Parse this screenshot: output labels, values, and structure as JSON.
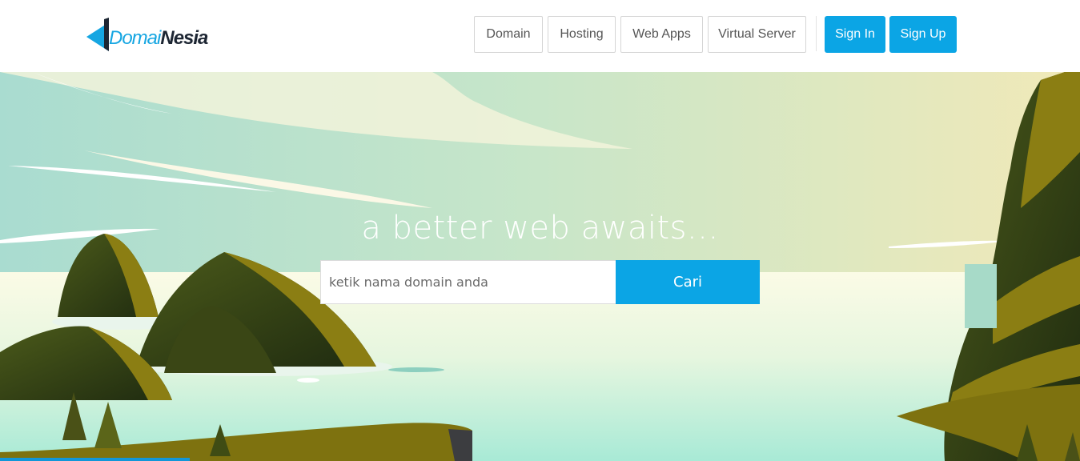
{
  "brand": {
    "name_part1": "Domai",
    "name_part2": "Nesia",
    "color_accent": "#16a6e2",
    "color_dark": "#1d2633"
  },
  "nav": {
    "items": [
      {
        "label": "Domain"
      },
      {
        "label": "Hosting"
      },
      {
        "label": "Web Apps"
      },
      {
        "label": "Virtual Server"
      }
    ],
    "sign_in": "Sign In",
    "sign_up": "Sign Up"
  },
  "hero": {
    "tagline": "a better web awaits...",
    "search": {
      "placeholder": "ketik nama domain anda",
      "value": "",
      "button_label": "Cari"
    }
  },
  "colors": {
    "primary": "#0ba5e5"
  }
}
